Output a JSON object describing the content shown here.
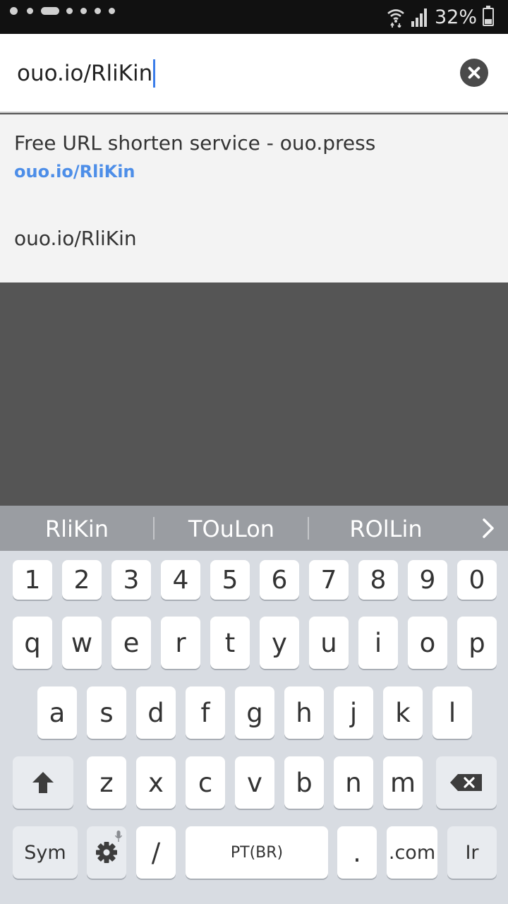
{
  "status_bar": {
    "battery_percent_text": "32%",
    "battery_level": 0.32,
    "icons": [
      "notification-dot-icon",
      "notification-pill-icon",
      "wifi-icon",
      "cell-signal-icon",
      "battery-icon"
    ]
  },
  "url_bar": {
    "value": "ouo.io/RliKin",
    "clear_icon": "close-circle-icon"
  },
  "suggestions": {
    "items": [
      {
        "title": "Free URL shorten service - ouo.press",
        "url": "ouo.io/RliKin"
      },
      {
        "title": "ouo.io/RliKin"
      }
    ]
  },
  "prediction_bar": {
    "words": [
      "RliKin",
      "TOuLon",
      "ROlLin"
    ],
    "more_icon": "chevron-right-icon"
  },
  "keyboard": {
    "rows": [
      [
        "1",
        "2",
        "3",
        "4",
        "5",
        "6",
        "7",
        "8",
        "9",
        "0"
      ],
      [
        "q",
        "w",
        "e",
        "r",
        "t",
        "y",
        "u",
        "i",
        "o",
        "p"
      ],
      [
        "a",
        "s",
        "d",
        "f",
        "g",
        "h",
        "j",
        "k",
        "l"
      ],
      [
        "z",
        "x",
        "c",
        "v",
        "b",
        "n",
        "m"
      ]
    ],
    "sym_label": "Sym",
    "slash_label": "/",
    "space_label": "PT(BR)",
    "period_label": ".",
    "dotcom_label": ".com",
    "enter_label": "Ir"
  },
  "colors": {
    "accent": "#3b7de9",
    "link": "#4d8ee8",
    "prediction_bar": "#9a9da2",
    "keyboard_bg": "#d8dce2"
  }
}
